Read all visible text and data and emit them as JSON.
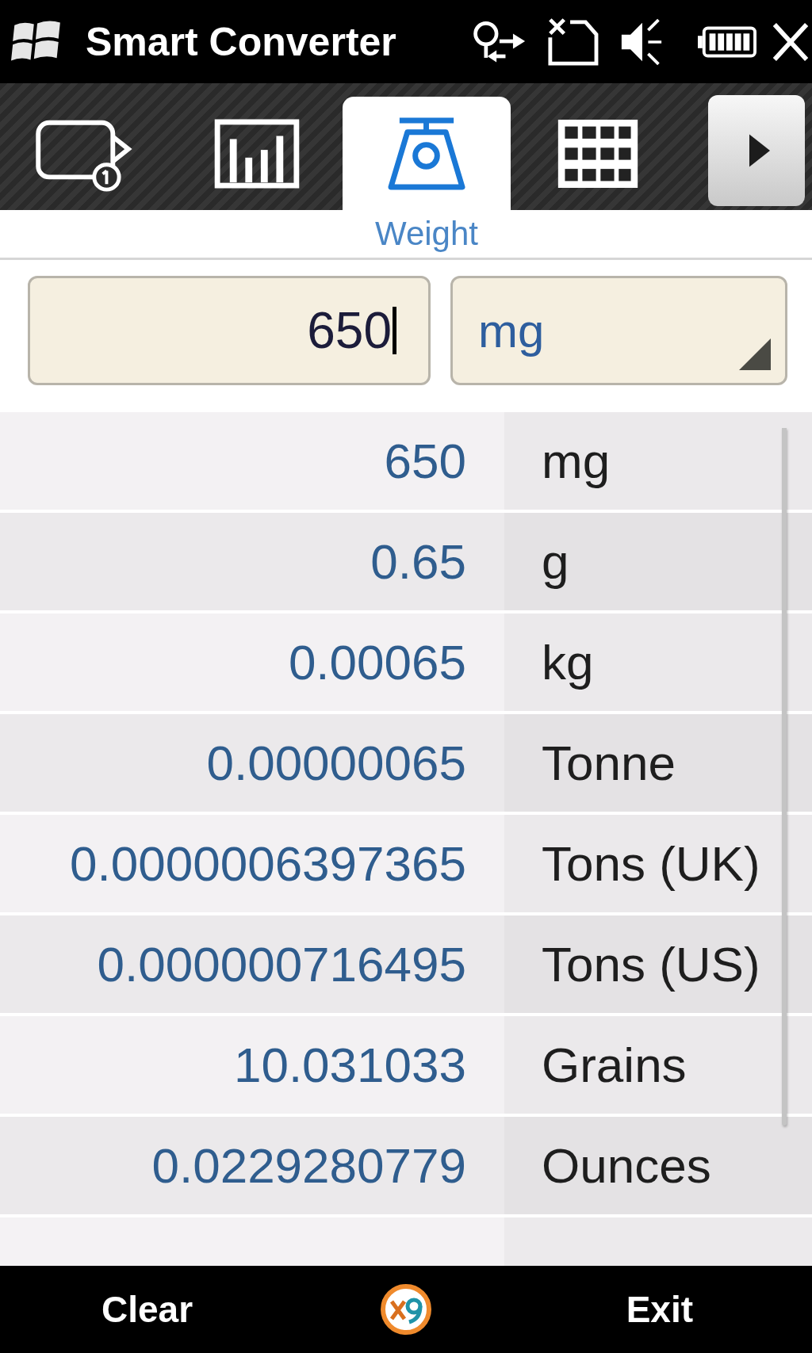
{
  "window": {
    "title": "Smart Converter"
  },
  "tabs": [
    {
      "kind": "device",
      "selected": false
    },
    {
      "kind": "chart",
      "selected": false
    },
    {
      "kind": "scale",
      "label": "Weight",
      "selected": true
    },
    {
      "kind": "grid",
      "selected": false
    }
  ],
  "input": {
    "value": "650",
    "focused": true
  },
  "unit_select": {
    "value": "mg"
  },
  "results": [
    {
      "value": "650",
      "unit": "mg"
    },
    {
      "value": "0.65",
      "unit": "g"
    },
    {
      "value": "0.00065",
      "unit": "kg"
    },
    {
      "value": "0.00000065",
      "unit": "Tonne"
    },
    {
      "value": "0.0000006397365",
      "unit": "Tons (UK)"
    },
    {
      "value": "0.000000716495",
      "unit": "Tons (US)"
    },
    {
      "value": "10.031033",
      "unit": "Grains"
    },
    {
      "value": "0.0229280779",
      "unit": "Ounces"
    }
  ],
  "softkeys": {
    "left": "Clear",
    "right": "Exit"
  }
}
